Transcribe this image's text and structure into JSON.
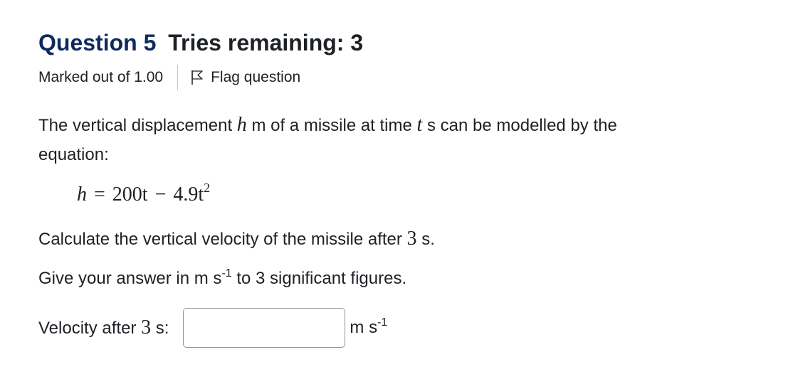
{
  "question": {
    "label": "Question",
    "number": "5",
    "tries": "Tries remaining: 3"
  },
  "meta": {
    "marked": "Marked out of 1.00",
    "flag": "Flag question"
  },
  "text": {
    "line1_a": "The vertical displacement ",
    "var_h": "h",
    "line1_b": " m of a missile at time ",
    "var_t": "t",
    "line1_c": " s can be modelled by the",
    "line2": "equation:",
    "calc_a": "Calculate the vertical velocity of the missile after ",
    "calc_num": "3",
    "calc_b": " s.",
    "give_a": "Give your answer in m s",
    "give_sup": "-1",
    "give_b": " to 3 significant figures."
  },
  "equation": {
    "lhs": "h",
    "eq": "=",
    "term1": "200t",
    "minus": "−",
    "term2": "4.9t",
    "exp": "2"
  },
  "answer": {
    "label_a": "Velocity after ",
    "label_num": "3",
    "label_b": " s:",
    "value": "",
    "unit": "m s",
    "unit_sup": "-1"
  },
  "colors": {
    "heading": "#0f2a5c",
    "text": "#1d2125",
    "input_border": "#8f959e"
  },
  "icons": {
    "flag": "flag-outline-icon"
  }
}
